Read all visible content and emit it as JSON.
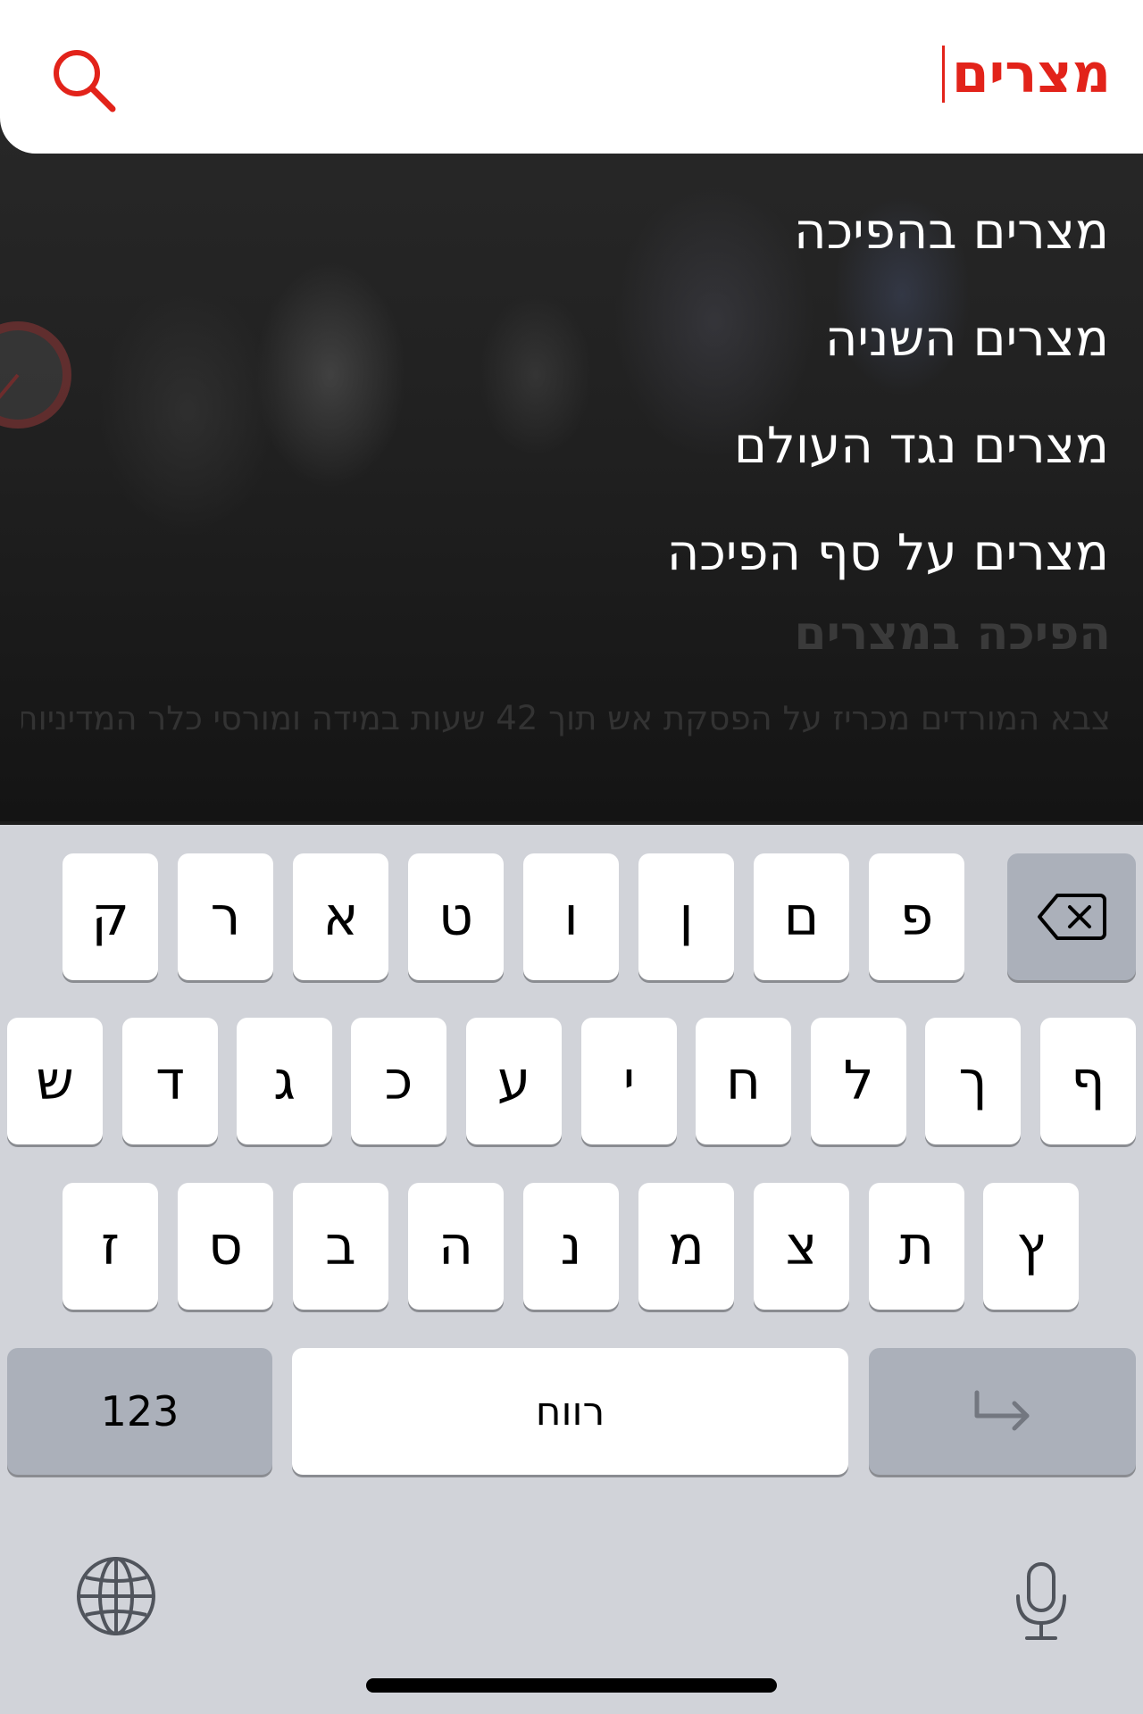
{
  "search": {
    "query": "מצרים",
    "accent_color": "#e2231a",
    "icon": "search-icon"
  },
  "suggestions": [
    "מצרים בהפיכה",
    "מצרים השניה",
    "מצרים נגד העולם",
    "מצרים על סף הפיכה"
  ],
  "article": {
    "title": "הפיכה במצרים",
    "description": "צבא המורדים מכריז על הפסקת אש תוך 42 שעות במידה ומורסי כלר המדיניות ויתפטר מתפקידו הממשלה המכהן צבא המורדים מכריזים.."
  },
  "keyboard": {
    "row1": [
      "ק",
      "ר",
      "א",
      "ט",
      "ו",
      "ן",
      "ם",
      "פ"
    ],
    "row2": [
      "ש",
      "ד",
      "ג",
      "כ",
      "ע",
      "י",
      "ח",
      "ל",
      "ך",
      "ף"
    ],
    "row3": [
      "ז",
      "ס",
      "ב",
      "ה",
      "נ",
      "מ",
      "צ",
      "ת",
      "ץ"
    ],
    "numbers_label": "123",
    "space_label": "רווח",
    "backspace_icon": "backspace-icon",
    "return_icon": "return-icon",
    "globe_icon": "globe-icon",
    "mic_icon": "microphone-icon"
  }
}
